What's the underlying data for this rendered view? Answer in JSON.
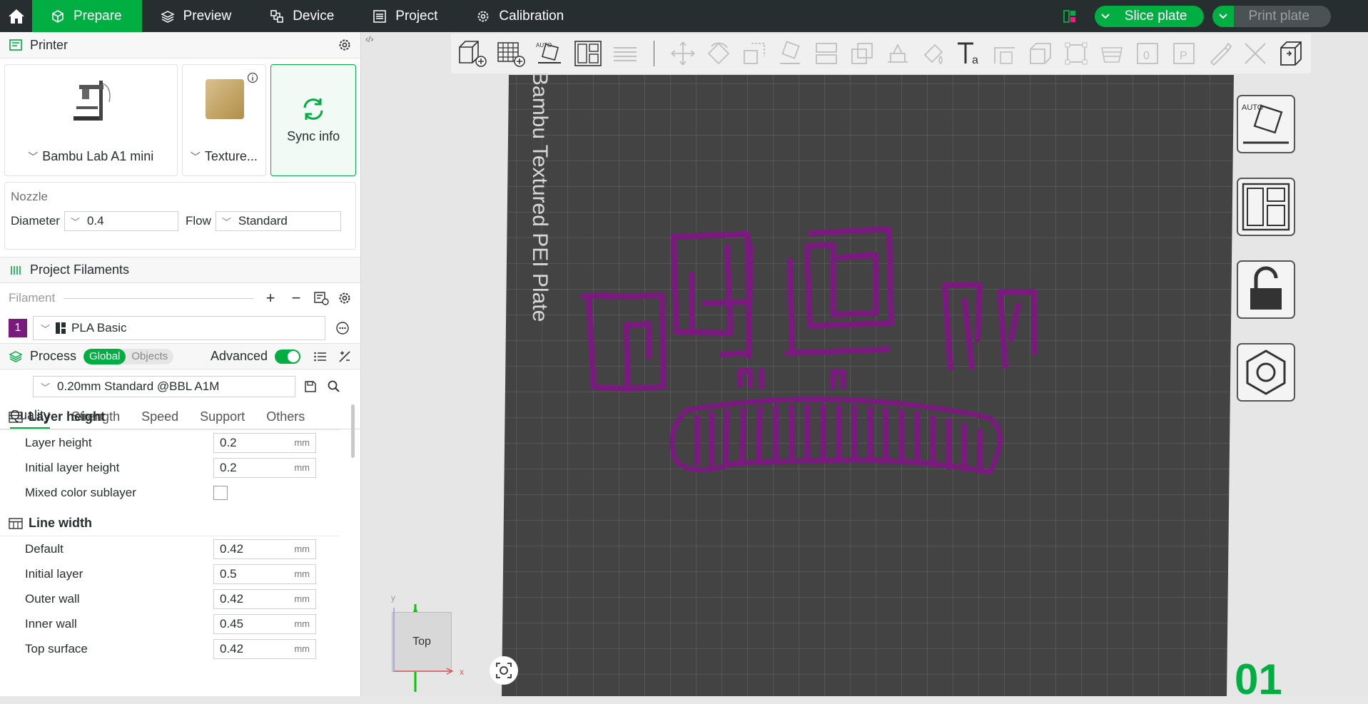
{
  "topbar": {
    "tabs": [
      {
        "label": "Prepare",
        "icon": "cube-icon",
        "active": true
      },
      {
        "label": "Preview",
        "icon": "layers-icon",
        "active": false
      },
      {
        "label": "Device",
        "icon": "device-icon",
        "active": false
      },
      {
        "label": "Project",
        "icon": "project-icon",
        "active": false
      },
      {
        "label": "Calibration",
        "icon": "calibration-icon",
        "active": false
      }
    ],
    "slice_label": "Slice plate",
    "print_label": "Print plate",
    "accent": "#00ae42"
  },
  "printer": {
    "header": "Printer",
    "printer_name": "Bambu Lab A1 mini",
    "plate_name": "Texture...",
    "sync_label": "Sync info"
  },
  "nozzle": {
    "label": "Nozzle",
    "diameter_label": "Diameter",
    "diameter_value": "0.4",
    "flow_label": "Flow",
    "flow_value": "Standard"
  },
  "filaments": {
    "header": "Project Filaments",
    "bar_label": "Filament",
    "items": [
      {
        "index": "1",
        "name": "PLA Basic",
        "color": "#7a1a7e"
      }
    ]
  },
  "process": {
    "header": "Process",
    "scope_global": "Global",
    "scope_objects": "Objects",
    "advanced_label": "Advanced",
    "preset": "0.20mm Standard @BBL A1M",
    "tabs": [
      "Quality",
      "Strength",
      "Speed",
      "Support",
      "Others"
    ]
  },
  "settings": {
    "groups": [
      {
        "title": "Layer height",
        "options": [
          {
            "name": "Layer height",
            "value": "0.2",
            "unit": "mm"
          },
          {
            "name": "Initial layer height",
            "value": "0.2",
            "unit": "mm"
          },
          {
            "name": "Mixed color sublayer",
            "checkbox": true
          }
        ]
      },
      {
        "title": "Line width",
        "options": [
          {
            "name": "Default",
            "value": "0.42",
            "unit": "mm"
          },
          {
            "name": "Initial layer",
            "value": "0.5",
            "unit": "mm"
          },
          {
            "name": "Outer wall",
            "value": "0.42",
            "unit": "mm"
          },
          {
            "name": "Inner wall",
            "value": "0.45",
            "unit": "mm"
          },
          {
            "name": "Top surface",
            "value": "0.42",
            "unit": "mm"
          }
        ]
      }
    ]
  },
  "viewport": {
    "plate_label": "Bambu Textured PEI Plate",
    "plate_number": "01",
    "view_cube_label": "Top",
    "axis_x": "x",
    "axis_y": "y",
    "model_color": "#7a1a7e"
  }
}
